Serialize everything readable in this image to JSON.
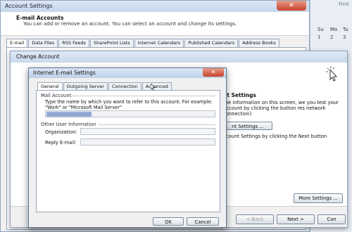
{
  "background": {
    "find_label": "Find",
    "calendar": {
      "days": [
        "Su",
        "Mo",
        "Tu"
      ],
      "dates": [
        "1",
        "2",
        "3"
      ]
    }
  },
  "account_settings": {
    "title": "Account Settings",
    "header_title": "E-mail Accounts",
    "header_subtitle": "You can add or remove an account. You can select an account and change its settings.",
    "tabs": [
      "E-mail",
      "Data Files",
      "RSS Feeds",
      "SharePoint Lists",
      "Internet Calendars",
      "Published Calendars",
      "Address Books"
    ]
  },
  "change_account": {
    "title": "Change Account",
    "test_section_title": "nt Settings",
    "test_section_desc": "the information on this screen, we you test your account by clicking the button res network connection)",
    "test_button": "nt Settings ...",
    "next_desc": "ccount Settings by clicking the Next button",
    "more_settings_button": "More Settings ...",
    "back_button": "< Back",
    "next_button": "Next >",
    "cancel_button": "Can"
  },
  "email_settings_dialog": {
    "title": "Internet E-mail Settings",
    "tabs": [
      "General",
      "Outgoing Server",
      "Connection",
      "Advanced"
    ],
    "mail_account_label": "Mail Account",
    "mail_account_desc": "Type the name by which you want to refer to this account. For example: \"Work\" or \"Microsoft Mail Server\"",
    "account_name_value": "",
    "other_info_label": "Other User Information",
    "organization_label": "Organization:",
    "organization_value": "",
    "reply_email_label": "Reply E-mail:",
    "reply_email_value": "",
    "ok_button": "OK",
    "cancel_button": "Cancel"
  }
}
